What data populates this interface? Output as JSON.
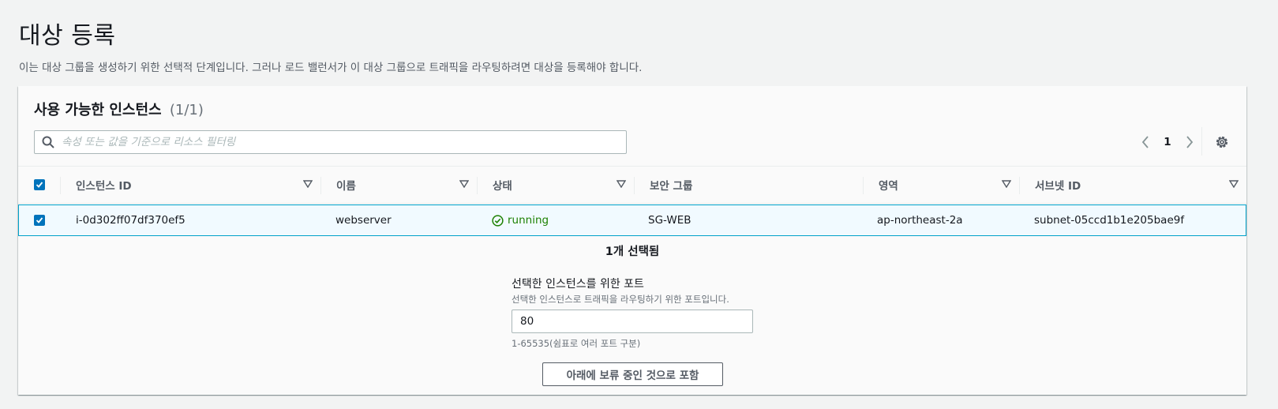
{
  "page": {
    "title": "대상 등록",
    "description": "이는 대상 그룹을 생성하기 위한 선택적 단계입니다. 그러나 로드 밸런서가 이 대상 그룹으로 트래픽을 라우팅하려면 대상을 등록해야 합니다."
  },
  "instances_panel": {
    "title": "사용 가능한 인스턴스",
    "count": "(1/1)",
    "filter_placeholder": "속성 또는 값을 기준으로 리소스 필터링",
    "pagination": {
      "current_page": "1"
    }
  },
  "table": {
    "columns": [
      {
        "label": "인스턴스 ID"
      },
      {
        "label": "이름"
      },
      {
        "label": "상태"
      },
      {
        "label": "보안 그룹"
      },
      {
        "label": "영역"
      },
      {
        "label": "서브넷 ID"
      }
    ],
    "rows": [
      {
        "instance_id": "i-0d302ff07df370ef5",
        "name": "webserver",
        "status": "running",
        "security_group": "SG-WEB",
        "zone": "ap-northeast-2a",
        "subnet_id": "subnet-05ccd1b1e205bae9f"
      }
    ]
  },
  "selection": {
    "summary": "1개 선택됨",
    "port_label": "선택한 인스턴스를 위한 포트",
    "port_description": "선택한 인스턴스로 트래픽을 라우팅하기 위한 포트입니다.",
    "port_value": "80",
    "port_hint": "1-65535(쉼표로 여러 포트 구분)",
    "include_button": "아래에 보류 중인 것으로 포함"
  },
  "colors": {
    "accent": "#0073bb",
    "status_running": "#1d8102",
    "selected_row_bg": "#f1faff",
    "selected_row_border": "#00a1c9"
  }
}
